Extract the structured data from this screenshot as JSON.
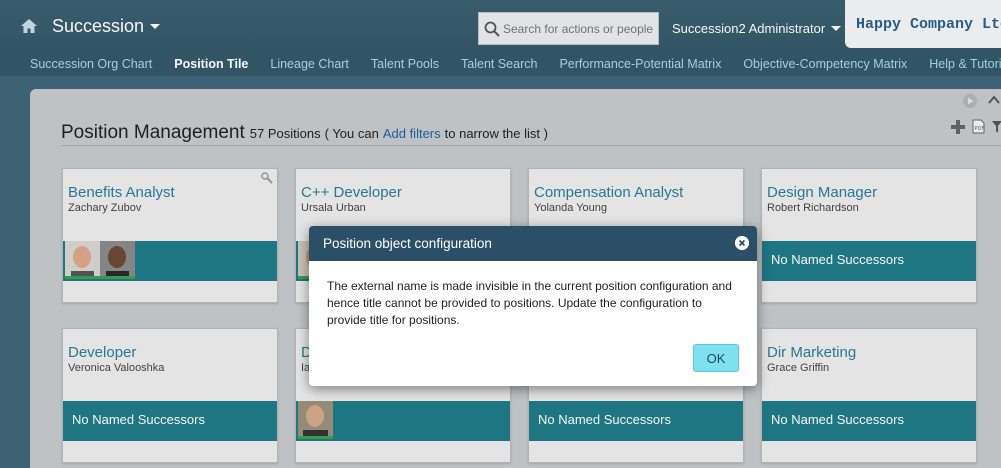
{
  "header": {
    "app_title": "Succession",
    "search_placeholder": "Search for actions or people",
    "user_name": "Succession2 Administrator",
    "company_logo_text": "Happy Company Ltd"
  },
  "subnav": {
    "items": [
      {
        "label": "Succession Org Chart",
        "active": false
      },
      {
        "label": "Position Tile",
        "active": true
      },
      {
        "label": "Lineage Chart",
        "active": false
      },
      {
        "label": "Talent Pools",
        "active": false
      },
      {
        "label": "Talent Search",
        "active": false
      },
      {
        "label": "Performance-Potential Matrix",
        "active": false
      },
      {
        "label": "Objective-Competency Matrix",
        "active": false
      },
      {
        "label": "Help & Tutorials",
        "active": false
      }
    ]
  },
  "page": {
    "title": "Position Management",
    "count": "57 Positions",
    "note_prefix": "( You can",
    "note_link": "Add filters",
    "note_suffix": "to narrow the list )"
  },
  "tiles": [
    {
      "title": "Benefits Analyst",
      "person": "Zachary Zubov",
      "band_text": "",
      "avatars": 2
    },
    {
      "title": "C++ Developer",
      "person": "Ursala Urban",
      "band_text": "",
      "avatars": 1
    },
    {
      "title": "Compensation Analyst",
      "person": "Yolanda Young",
      "band_text": "",
      "avatars": 0
    },
    {
      "title": "Design Manager",
      "person": "Robert Richardson",
      "band_text": "No Named Successors",
      "avatars": 0
    },
    {
      "title": "Developer",
      "person": "Veronica Valooshka",
      "band_text": "No Named Successors",
      "avatars": 0
    },
    {
      "title": "D",
      "person": "Ia",
      "band_text": "",
      "avatars": 1
    },
    {
      "title": "",
      "person": "",
      "band_text": "No Named Successors",
      "avatars": 0
    },
    {
      "title": "Dir Marketing",
      "person": "Grace Griffin",
      "band_text": "No Named Successors",
      "avatars": 0
    }
  ],
  "dialog": {
    "title": "Position object configuration",
    "message": "The external name is made invisible in the current position configuration and hence title cannot be provided to positions. Update the configuration to provide title for positions.",
    "ok_label": "OK"
  },
  "icons": {
    "home": "home-icon",
    "search": "search-icon",
    "close": "close-icon",
    "wrench": "wrench-icon",
    "add": "plus-icon",
    "pdf": "pdf-icon",
    "filter": "filter-icon",
    "play": "play-icon",
    "collapse": "chevron-up-icon"
  },
  "colors": {
    "header_bg": "#3b5f6f",
    "nav_link": "#a9d7e8",
    "tile_band": "#1e7a86",
    "tile_title": "#2a7b98",
    "dialog_header": "#2a4f66",
    "ok_button": "#7fe0f0"
  }
}
